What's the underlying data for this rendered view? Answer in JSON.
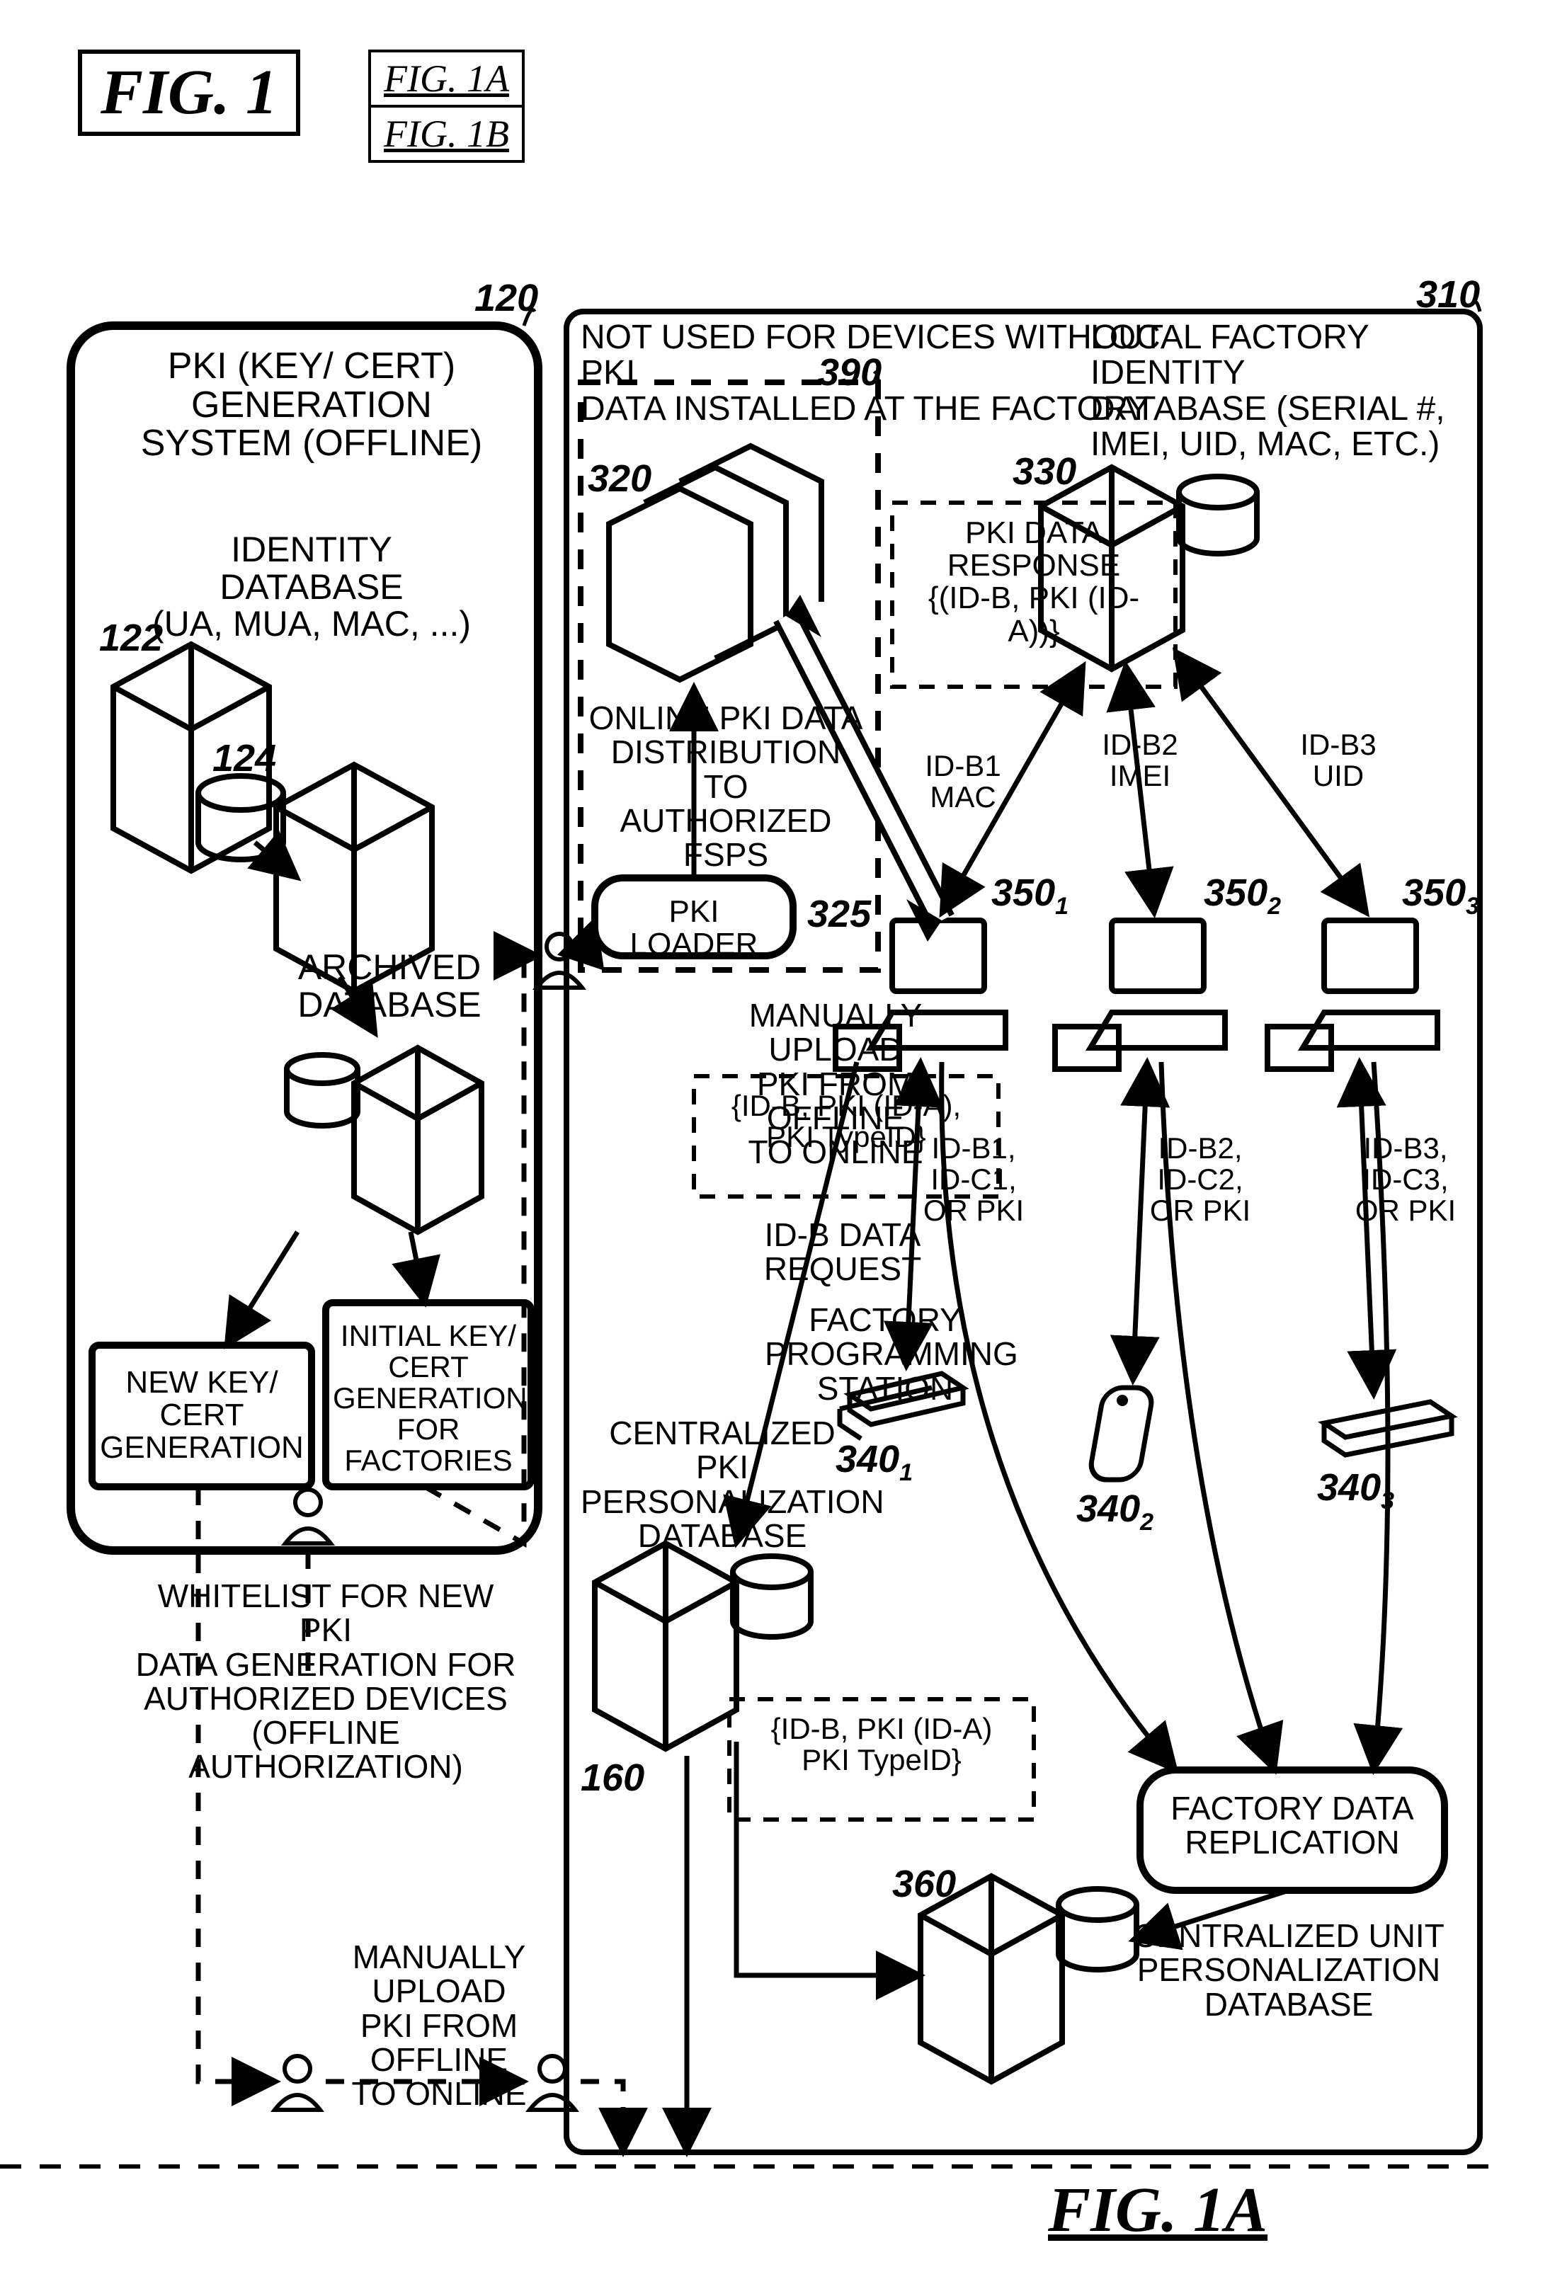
{
  "figure_titles": {
    "main": "FIG. 1",
    "table": [
      [
        "FIG. 1A"
      ],
      [
        "FIG. 1B"
      ]
    ],
    "subfig": "FIG. 1A"
  },
  "refs": {
    "r120": "120",
    "r122": "122",
    "r124": "124",
    "r160": "160",
    "r310": "310",
    "r320": "320",
    "r325": "325",
    "r330": "330",
    "r340_1": "340",
    "r340_2": "340",
    "r340_3": "340",
    "r350_1": "350",
    "r350_2": "350",
    "r350_3": "350",
    "r360": "360",
    "r390": "390"
  },
  "labels": {
    "pki_gen_title": "PKI (KEY/ CERT) GENERATION\nSYSTEM (OFFLINE)",
    "identity_db": "IDENTITY DATABASE\n(UA, MUA, MAC, ...)",
    "archived_db": "ARCHIVED\nDATABASE",
    "new_key_gen": "NEW KEY/ CERT\nGENERATION",
    "initial_key_gen": "INITIAL KEY/ CERT\nGENERATION FOR\nFACTORIES",
    "whitelist": "WHITELIST FOR NEW PKI\nDATA GENERATION FOR\nAUTHORIZED DEVICES\n(OFFLINE AUTHORIZATION)",
    "manual_upload_left": "MANUALLY UPLOAD\nPKI FROM OFFLINE\nTO ONLINE",
    "manual_upload_mid": "MANUALLY UPLOAD\nPKI FROM OFFLINE\nTO ONLINE",
    "online_pki": "ONLINE PKI DATA\nDISTRIBUTION TO\nAUTHORIZED FSPS",
    "pki_loader": "PKI LOADER",
    "not_used": "NOT USED FOR DEVICES WITHOUT PKI\nDATA INSTALLED AT THE FACTORY",
    "centralized_pki": "CENTRALIZED PKI\nPERSONALIZATION\nDATABASE",
    "local_factory_db": "LOCAL FACTORY IDENTITY\nDATABASE (SERIAL #,\nIMEI, UID, MAC, ETC.)",
    "pki_data_response": "PKI DATA\nRESPONSE\n{(ID-B, PKI (ID-A))}",
    "id_b_request": "ID-B DATA\nREQUEST",
    "factory_station": "FACTORY\nPROGRAMMING\nSTATION",
    "factory_replication": "FACTORY DATA\nREPLICATION",
    "cent_unit_db": "CENTRALIZED UNIT\nPERSONALIZATION\nDATABASE",
    "id_b1_mac": "ID-B1\nMAC",
    "id_b2_imei": "ID-B2\nIMEI",
    "id_b3_uid": "ID-B3\nUID",
    "id_tuple1": "ID-B1,\nID-C1,\nOR PKI",
    "id_tuple2": "ID-B2,\nID-C2,\nOR PKI",
    "id_tuple3": "ID-B3,\nID-C3,\nOR PKI",
    "tuple_mid": "{ID-B, PKI (ID-A),\nPKI TypeID}",
    "tuple_bottom": "{ID-B, PKI (ID-A)\nPKI TypeID}"
  }
}
